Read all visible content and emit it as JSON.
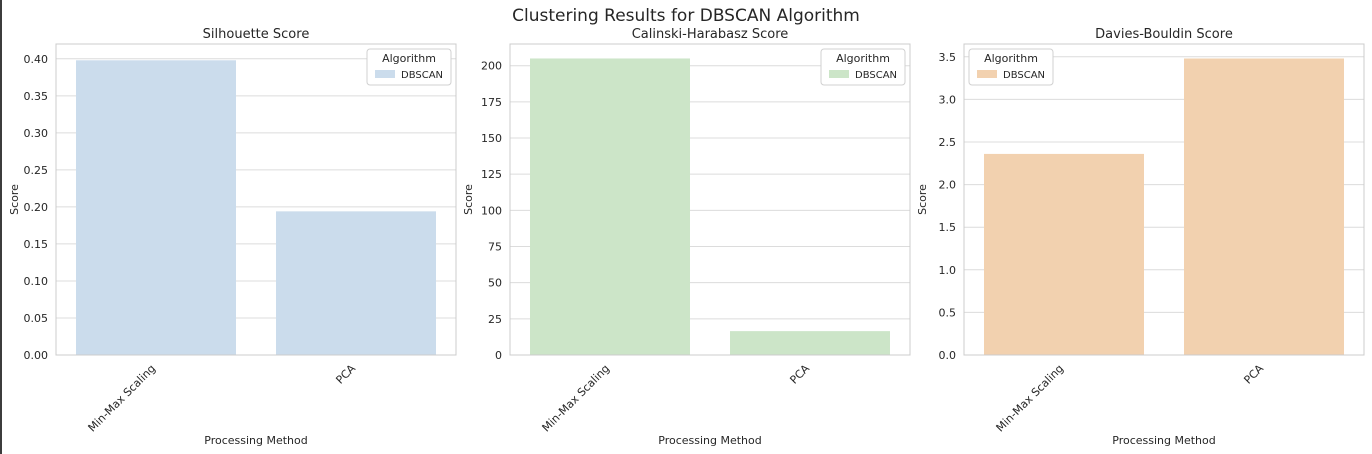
{
  "figure": {
    "title": "Clustering Results for DBSCAN Algorithm"
  },
  "chart_data": [
    {
      "type": "bar",
      "title": "Silhouette Score",
      "xlabel": "Processing Method",
      "ylabel": "Score",
      "categories": [
        "Min-Max Scaling",
        "PCA"
      ],
      "series": [
        {
          "name": "DBSCAN",
          "values": [
            0.398,
            0.194
          ]
        }
      ],
      "ylim": [
        0,
        0.42
      ],
      "yticks": [
        0.0,
        0.05,
        0.1,
        0.15,
        0.2,
        0.25,
        0.3,
        0.35,
        0.4
      ],
      "ytick_labels": [
        "0.00",
        "0.05",
        "0.10",
        "0.15",
        "0.20",
        "0.25",
        "0.30",
        "0.35",
        "0.40"
      ],
      "grid": true,
      "legend": {
        "title": "Algorithm",
        "placement": "upper right"
      },
      "color": "#cbdcec"
    },
    {
      "type": "bar",
      "title": "Calinski-Harabasz Score",
      "xlabel": "Processing Method",
      "ylabel": "Score",
      "categories": [
        "Min-Max Scaling",
        "PCA"
      ],
      "series": [
        {
          "name": "DBSCAN",
          "values": [
            205,
            16.5
          ]
        }
      ],
      "ylim": [
        0,
        215
      ],
      "yticks": [
        0,
        25,
        50,
        75,
        100,
        125,
        150,
        175,
        200
      ],
      "ytick_labels": [
        "0",
        "25",
        "50",
        "75",
        "100",
        "125",
        "150",
        "175",
        "200"
      ],
      "grid": true,
      "legend": {
        "title": "Algorithm",
        "placement": "upper right"
      },
      "color": "#cce5c8"
    },
    {
      "type": "bar",
      "title": "Davies-Bouldin Score",
      "xlabel": "Processing Method",
      "ylabel": "Score",
      "categories": [
        "Min-Max Scaling",
        "PCA"
      ],
      "series": [
        {
          "name": "DBSCAN",
          "values": [
            2.36,
            3.48
          ]
        }
      ],
      "ylim": [
        0,
        3.65
      ],
      "yticks": [
        0.0,
        0.5,
        1.0,
        1.5,
        2.0,
        2.5,
        3.0,
        3.5
      ],
      "ytick_labels": [
        "0.0",
        "0.5",
        "1.0",
        "1.5",
        "2.0",
        "2.5",
        "3.0",
        "3.5"
      ],
      "grid": true,
      "legend": {
        "title": "Algorithm",
        "placement": "upper left"
      },
      "color": "#f2d1af"
    }
  ]
}
